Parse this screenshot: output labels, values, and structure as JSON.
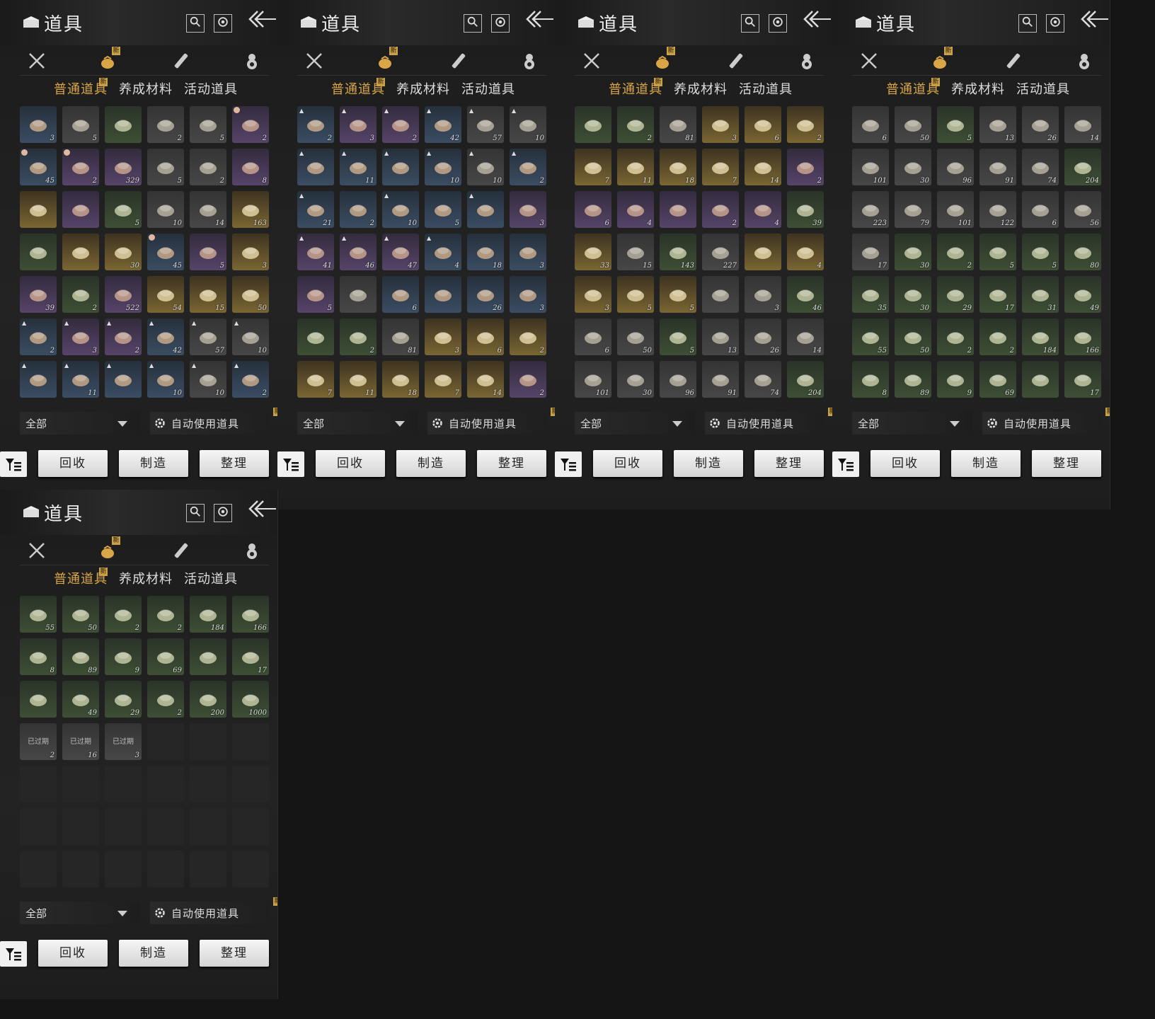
{
  "ui": {
    "title": "道具",
    "new_badge": "新",
    "subtabs": [
      "普通道具",
      "养成材料",
      "活动道具"
    ],
    "filter_label": "全部",
    "auto_use_label": "自动使用道具",
    "buttons": {
      "recycle": "回收",
      "craft": "制造",
      "sort": "整理"
    }
  },
  "panels": [
    {
      "cells": [
        {
          "q": "blue",
          "n": "3"
        },
        {
          "q": "gray",
          "n": "5"
        },
        {
          "q": "green",
          "n": ""
        },
        {
          "q": "gray",
          "n": "2"
        },
        {
          "q": "gray",
          "n": "5"
        },
        {
          "q": "purple",
          "n": "2",
          "clock": true
        },
        {
          "q": "blue",
          "n": "45",
          "clock": true
        },
        {
          "q": "purple",
          "n": "2",
          "clock": true
        },
        {
          "q": "purple",
          "n": "329"
        },
        {
          "q": "gray",
          "n": "5"
        },
        {
          "q": "gray",
          "n": "2"
        },
        {
          "q": "purple",
          "n": "8"
        },
        {
          "q": "gold",
          "n": ""
        },
        {
          "q": "purple",
          "n": ""
        },
        {
          "q": "green",
          "n": "5"
        },
        {
          "q": "gray",
          "n": "10"
        },
        {
          "q": "gray",
          "n": "14"
        },
        {
          "q": "gold",
          "n": "163"
        },
        {
          "q": "green",
          "n": ""
        },
        {
          "q": "gold",
          "n": ""
        },
        {
          "q": "gold",
          "n": "30"
        },
        {
          "q": "blue",
          "n": "45",
          "clock": true
        },
        {
          "q": "purple",
          "n": "5"
        },
        {
          "q": "gold",
          "n": "3"
        },
        {
          "q": "purple",
          "n": "39"
        },
        {
          "q": "green",
          "n": "2"
        },
        {
          "q": "purple",
          "n": "522"
        },
        {
          "q": "gold",
          "n": "54"
        },
        {
          "q": "gold",
          "n": "15"
        },
        {
          "q": "gold",
          "n": "50"
        },
        {
          "q": "blue",
          "n": "2",
          "up": true
        },
        {
          "q": "purple",
          "n": "3",
          "up": true
        },
        {
          "q": "purple",
          "n": "2",
          "up": true
        },
        {
          "q": "blue",
          "n": "42",
          "up": true
        },
        {
          "q": "gray",
          "n": "57",
          "up": true
        },
        {
          "q": "gray",
          "n": "10",
          "up": true
        },
        {
          "q": "blue",
          "n": "",
          "up": true
        },
        {
          "q": "blue",
          "n": "11",
          "up": true
        },
        {
          "q": "blue",
          "n": "",
          "up": true
        },
        {
          "q": "blue",
          "n": "10",
          "up": true
        },
        {
          "q": "gray",
          "n": "10",
          "up": true
        },
        {
          "q": "blue",
          "n": "2",
          "up": true
        }
      ]
    },
    {
      "cells": [
        {
          "q": "blue",
          "n": "2",
          "up": true
        },
        {
          "q": "purple",
          "n": "3",
          "up": true
        },
        {
          "q": "purple",
          "n": "2",
          "up": true
        },
        {
          "q": "blue",
          "n": "42",
          "up": true
        },
        {
          "q": "gray",
          "n": "57",
          "up": true
        },
        {
          "q": "gray",
          "n": "10",
          "up": true
        },
        {
          "q": "blue",
          "n": "",
          "up": true
        },
        {
          "q": "blue",
          "n": "11",
          "up": true
        },
        {
          "q": "blue",
          "n": "",
          "up": true
        },
        {
          "q": "blue",
          "n": "10",
          "up": true
        },
        {
          "q": "gray",
          "n": "10",
          "up": true
        },
        {
          "q": "blue",
          "n": "2",
          "up": true
        },
        {
          "q": "blue",
          "n": "21",
          "up": true
        },
        {
          "q": "blue",
          "n": "2"
        },
        {
          "q": "blue",
          "n": "10",
          "up": true
        },
        {
          "q": "blue",
          "n": "5"
        },
        {
          "q": "blue",
          "n": "",
          "up": true
        },
        {
          "q": "purple",
          "n": "3"
        },
        {
          "q": "purple",
          "n": "41",
          "up": true
        },
        {
          "q": "purple",
          "n": "46",
          "up": true
        },
        {
          "q": "purple",
          "n": "47",
          "up": true
        },
        {
          "q": "blue",
          "n": "4",
          "up": true
        },
        {
          "q": "blue",
          "n": "18"
        },
        {
          "q": "blue",
          "n": "3"
        },
        {
          "q": "purple",
          "n": "5"
        },
        {
          "q": "gray",
          "n": ""
        },
        {
          "q": "blue",
          "n": "6"
        },
        {
          "q": "blue",
          "n": ""
        },
        {
          "q": "blue",
          "n": "26"
        },
        {
          "q": "blue",
          "n": "3"
        },
        {
          "q": "green",
          "n": ""
        },
        {
          "q": "green",
          "n": "2"
        },
        {
          "q": "gray",
          "n": "81"
        },
        {
          "q": "gold",
          "n": "3"
        },
        {
          "q": "gold",
          "n": "6"
        },
        {
          "q": "gold",
          "n": "2"
        },
        {
          "q": "gold",
          "n": "7"
        },
        {
          "q": "gold",
          "n": "11"
        },
        {
          "q": "gold",
          "n": "18"
        },
        {
          "q": "gold",
          "n": "7"
        },
        {
          "q": "gold",
          "n": "14"
        },
        {
          "q": "purple",
          "n": "2"
        }
      ]
    },
    {
      "cells": [
        {
          "q": "green",
          "n": ""
        },
        {
          "q": "green",
          "n": "2"
        },
        {
          "q": "gray",
          "n": "81"
        },
        {
          "q": "gold",
          "n": "3"
        },
        {
          "q": "gold",
          "n": "6"
        },
        {
          "q": "gold",
          "n": "2"
        },
        {
          "q": "gold",
          "n": "7"
        },
        {
          "q": "gold",
          "n": "11"
        },
        {
          "q": "gold",
          "n": "18"
        },
        {
          "q": "gold",
          "n": "7"
        },
        {
          "q": "gold",
          "n": "14"
        },
        {
          "q": "purple",
          "n": "2"
        },
        {
          "q": "purple",
          "n": "6"
        },
        {
          "q": "purple",
          "n": "4"
        },
        {
          "q": "purple",
          "n": ""
        },
        {
          "q": "purple",
          "n": "2"
        },
        {
          "q": "purple",
          "n": "4"
        },
        {
          "q": "green",
          "n": "39"
        },
        {
          "q": "gold",
          "n": "33"
        },
        {
          "q": "gray",
          "n": "15"
        },
        {
          "q": "green",
          "n": "143"
        },
        {
          "q": "gray",
          "n": "227"
        },
        {
          "q": "gold",
          "n": ""
        },
        {
          "q": "gold",
          "n": "4"
        },
        {
          "q": "gold",
          "n": "3"
        },
        {
          "q": "gold",
          "n": "5"
        },
        {
          "q": "gold",
          "n": "5"
        },
        {
          "q": "gray",
          "n": ""
        },
        {
          "q": "gray",
          "n": "3"
        },
        {
          "q": "green",
          "n": "46"
        },
        {
          "q": "gray",
          "n": "6"
        },
        {
          "q": "gray",
          "n": "50"
        },
        {
          "q": "green",
          "n": "5"
        },
        {
          "q": "gray",
          "n": "13"
        },
        {
          "q": "gray",
          "n": "26"
        },
        {
          "q": "gray",
          "n": "14"
        },
        {
          "q": "gray",
          "n": "101"
        },
        {
          "q": "gray",
          "n": "30"
        },
        {
          "q": "gray",
          "n": "96"
        },
        {
          "q": "gray",
          "n": "91"
        },
        {
          "q": "gray",
          "n": "74"
        },
        {
          "q": "green",
          "n": "204"
        }
      ]
    },
    {
      "cells": [
        {
          "q": "gray",
          "n": "6"
        },
        {
          "q": "gray",
          "n": "50"
        },
        {
          "q": "green",
          "n": "5"
        },
        {
          "q": "gray",
          "n": "13"
        },
        {
          "q": "gray",
          "n": "26"
        },
        {
          "q": "gray",
          "n": "14"
        },
        {
          "q": "gray",
          "n": "101"
        },
        {
          "q": "gray",
          "n": "30"
        },
        {
          "q": "gray",
          "n": "96"
        },
        {
          "q": "gray",
          "n": "91"
        },
        {
          "q": "gray",
          "n": "74"
        },
        {
          "q": "green",
          "n": "204"
        },
        {
          "q": "gray",
          "n": "223"
        },
        {
          "q": "gray",
          "n": "79"
        },
        {
          "q": "gray",
          "n": "101"
        },
        {
          "q": "gray",
          "n": "122"
        },
        {
          "q": "gray",
          "n": "6"
        },
        {
          "q": "gray",
          "n": "56"
        },
        {
          "q": "gray",
          "n": "17"
        },
        {
          "q": "green",
          "n": "30"
        },
        {
          "q": "green",
          "n": "2"
        },
        {
          "q": "green",
          "n": "5"
        },
        {
          "q": "green",
          "n": "5"
        },
        {
          "q": "green",
          "n": "80"
        },
        {
          "q": "green",
          "n": "35"
        },
        {
          "q": "green",
          "n": "30"
        },
        {
          "q": "green",
          "n": "29"
        },
        {
          "q": "green",
          "n": "17"
        },
        {
          "q": "green",
          "n": "31"
        },
        {
          "q": "green",
          "n": "49"
        },
        {
          "q": "green",
          "n": "55"
        },
        {
          "q": "green",
          "n": "50"
        },
        {
          "q": "green",
          "n": "2"
        },
        {
          "q": "green",
          "n": "2"
        },
        {
          "q": "green",
          "n": "184"
        },
        {
          "q": "green",
          "n": "166"
        },
        {
          "q": "green",
          "n": "8"
        },
        {
          "q": "green",
          "n": "89"
        },
        {
          "q": "green",
          "n": "9"
        },
        {
          "q": "green",
          "n": "69"
        },
        {
          "q": "green",
          "n": ""
        },
        {
          "q": "green",
          "n": "17"
        }
      ]
    },
    {
      "cells": [
        {
          "q": "green",
          "n": "55"
        },
        {
          "q": "green",
          "n": "50"
        },
        {
          "q": "green",
          "n": "2"
        },
        {
          "q": "green",
          "n": "2"
        },
        {
          "q": "green",
          "n": "184"
        },
        {
          "q": "green",
          "n": "166"
        },
        {
          "q": "green",
          "n": "8"
        },
        {
          "q": "green",
          "n": "89"
        },
        {
          "q": "green",
          "n": "9"
        },
        {
          "q": "green",
          "n": "69"
        },
        {
          "q": "green",
          "n": ""
        },
        {
          "q": "green",
          "n": "17"
        },
        {
          "q": "green",
          "n": ""
        },
        {
          "q": "green",
          "n": "49"
        },
        {
          "q": "green",
          "n": "29"
        },
        {
          "q": "green",
          "n": "2"
        },
        {
          "q": "green",
          "n": "200"
        },
        {
          "q": "green",
          "n": "1000"
        },
        {
          "q": "gray",
          "n": "2",
          "exp": "已过期"
        },
        {
          "q": "gray",
          "n": "16",
          "exp": "已过期"
        },
        {
          "q": "gray",
          "n": "3",
          "exp": "已过期"
        },
        {
          "q": "empty"
        },
        {
          "q": "empty"
        },
        {
          "q": "empty"
        },
        {
          "q": "empty"
        },
        {
          "q": "empty"
        },
        {
          "q": "empty"
        },
        {
          "q": "empty"
        },
        {
          "q": "empty"
        },
        {
          "q": "empty"
        },
        {
          "q": "empty"
        },
        {
          "q": "empty"
        },
        {
          "q": "empty"
        },
        {
          "q": "empty"
        },
        {
          "q": "empty"
        },
        {
          "q": "empty"
        },
        {
          "q": "empty"
        },
        {
          "q": "empty"
        },
        {
          "q": "empty"
        },
        {
          "q": "empty"
        },
        {
          "q": "empty"
        },
        {
          "q": "empty"
        }
      ]
    }
  ]
}
